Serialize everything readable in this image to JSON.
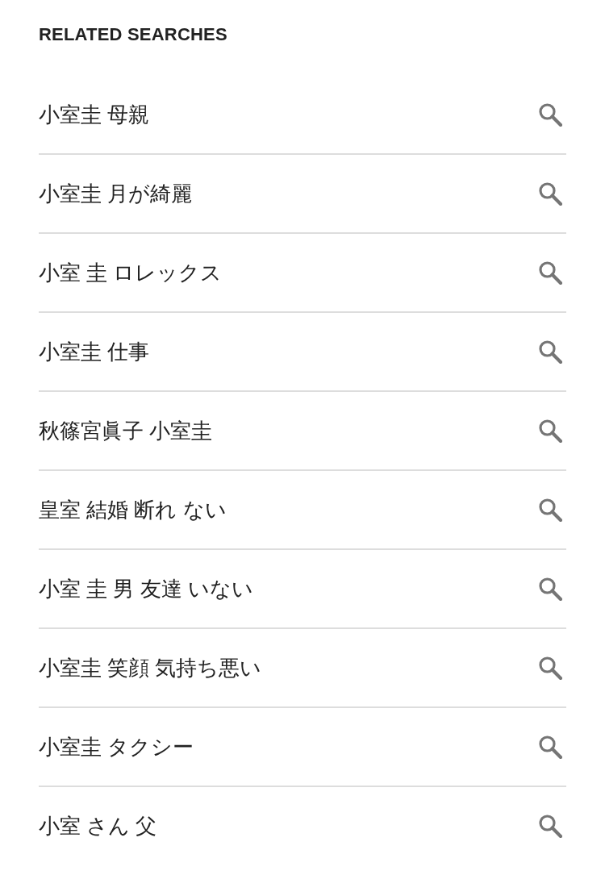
{
  "section": {
    "title": "RELATED SEARCHES"
  },
  "related_searches": [
    "小室圭 母親",
    "小室圭 月が綺麗",
    "小室 圭 ロレックス",
    "小室圭 仕事",
    "秋篠宮眞子 小室圭",
    "皇室 結婚 断れ ない",
    "小室 圭 男 友達 いない",
    "小室圭 笑顔 気持ち悪い",
    "小室圭 タクシー",
    "小室 さん 父"
  ]
}
